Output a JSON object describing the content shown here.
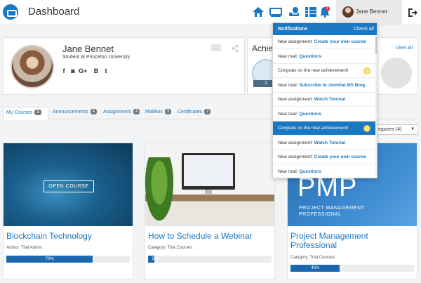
{
  "header": {
    "title": "Dashboard",
    "user_name": "Jane Bennet",
    "notification_count": "1",
    "icons": [
      "home-icon",
      "monitor-icon",
      "certificate-icon",
      "list-icon",
      "bell-icon",
      "logout-icon"
    ]
  },
  "profile": {
    "name": "Jane Bennet",
    "subtitle": "Student at Princeton University",
    "social": [
      "f",
      "◙",
      "G+",
      "B",
      "t"
    ]
  },
  "achievements": {
    "title": "Achie",
    "view_all": "View all",
    "badge_count": "1"
  },
  "tabs": [
    {
      "label": "My Courses",
      "count": "3",
      "active": true
    },
    {
      "label": "Announcements",
      "count": "4",
      "active": false
    },
    {
      "label": "Assignments",
      "count": "4",
      "active": false
    },
    {
      "label": "MailBox",
      "count": "3",
      "active": false
    },
    {
      "label": "Certificates",
      "count": "2",
      "active": false
    }
  ],
  "category_select": {
    "value": "egories (4)"
  },
  "courses": [
    {
      "title": "Blockchain Technology",
      "meta": "Author: Trial Admin",
      "progress_label": "70%",
      "progress": 0.7,
      "overlay": "OPEN COURSE"
    },
    {
      "title": "How to Schedule a Webinar",
      "meta": "Category: Trial Courses",
      "progress_label": "5%",
      "progress": 0.05
    },
    {
      "title": "Project Management Professional",
      "meta": "Category: Trial Courses",
      "progress_label": "40%",
      "progress": 0.4,
      "image_big": "PMP",
      "image_sub": "PROJECT MANAGEMENT PROFESSIONAL"
    }
  ],
  "notifications": {
    "title": "Notifications",
    "check_all": "Check all",
    "items": [
      {
        "prefix": "New assignment: ",
        "link": "Create your own course",
        "active": false
      },
      {
        "prefix": "New mail: ",
        "link": "Questions",
        "active": false
      },
      {
        "prefix": "Congrats on the new achievement!",
        "link": "",
        "active": false,
        "trophy": true
      },
      {
        "prefix": "New mail: ",
        "link": "Subscribe to JoomlaLMS Blog",
        "active": false
      },
      {
        "prefix": "New assignment: ",
        "link": "Watch Tutorial",
        "active": false
      },
      {
        "prefix": "New mail: ",
        "link": "Questions",
        "active": false
      },
      {
        "prefix": "Congrats on the new achievement!",
        "link": "",
        "active": true,
        "trophy": true
      },
      {
        "prefix": "New assignment: ",
        "link": "Watch Tutorial",
        "active": false
      },
      {
        "prefix": "New assignment: ",
        "link": "Create your own course",
        "active": false
      },
      {
        "prefix": "New mail: ",
        "link": "Questions",
        "active": false
      }
    ]
  },
  "colors": {
    "accent": "#1a78c2",
    "progress": "#1a68b0"
  }
}
